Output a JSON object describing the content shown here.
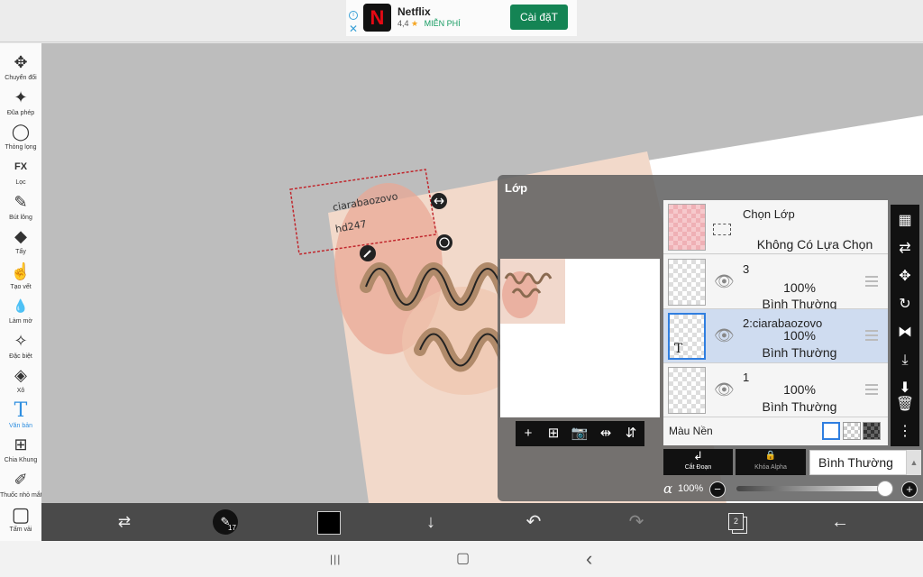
{
  "ad": {
    "title": "Netflix",
    "logo_letter": "N",
    "rating": "4,4",
    "star": "★",
    "badge": "MIỄN PHÍ",
    "install_label": "Cài đặT",
    "info_glyph": "i",
    "close_glyph": "✕"
  },
  "tools": [
    {
      "label": "Chuyển đổi",
      "icon": "move-icon",
      "glyph": "✥"
    },
    {
      "label": "Đũa phép",
      "icon": "magic-wand-icon",
      "glyph": "✦"
    },
    {
      "label": "Thòng lọng",
      "icon": "lasso-icon",
      "glyph": "◯"
    },
    {
      "label": "Lọc",
      "icon": "fx-icon",
      "glyph": "FX"
    },
    {
      "label": "Bút lông",
      "icon": "brush-icon",
      "glyph": "✎"
    },
    {
      "label": "Tẩy",
      "icon": "eraser-icon",
      "glyph": "◆"
    },
    {
      "label": "Tạo vết",
      "icon": "smudge-icon",
      "glyph": "☝"
    },
    {
      "label": "Làm mờ",
      "icon": "blur-icon",
      "glyph": "💧"
    },
    {
      "label": "Đặc biệt",
      "icon": "special-icon",
      "glyph": "✧"
    },
    {
      "label": "Xô",
      "icon": "bucket-icon",
      "glyph": "◈"
    },
    {
      "label": "Văn bản",
      "icon": "text-tool-icon",
      "glyph": "T"
    },
    {
      "label": "Chia Khung",
      "icon": "frame-divider-icon",
      "glyph": "⊞"
    },
    {
      "label": "Thuốc nhỏ mắt",
      "icon": "eyedropper-icon",
      "glyph": "✐"
    },
    {
      "label": "Tấm vải",
      "icon": "canvas-icon",
      "glyph": "▢"
    }
  ],
  "canvas": {
    "text_line1": "ciarabaozovo",
    "text_line2": "hd247"
  },
  "layer_panel": {
    "title": "Lớp",
    "selection_layer": {
      "title": "Chọn Lớp",
      "status": "Không Có Lựa Chọn"
    },
    "layers": [
      {
        "name": "3",
        "opacity": "100%",
        "blend": "Bình Thường",
        "selected": false
      },
      {
        "name": "2:ciarabaozovo",
        "opacity": "100%",
        "blend": "Bình Thường",
        "selected": true,
        "thumb_glyph": "T"
      },
      {
        "name": "1",
        "opacity": "100%",
        "blend": "Bình Thường",
        "selected": false
      }
    ],
    "background_label": "Màu Nền",
    "clip_label": "Cắt Đoạn",
    "alpha_lock_label": "Khóa Alpha",
    "blend_mode": "Bình Thường",
    "blend_arrow": "▲",
    "alpha_symbol": "α",
    "opacity_value": "100%",
    "opacity_fraction": 1.0,
    "minus_glyph": "−",
    "plus_glyph": "+",
    "eye_glyph": "👁",
    "preview_tool_glyphs": [
      "+",
      "⊞",
      "📷",
      "⇹",
      "⇵"
    ],
    "side_icon_glyphs": [
      "▦",
      "⇄",
      "✥",
      "↻",
      "⧓",
      "⤓",
      "⬇",
      "🗑",
      "⋮"
    ],
    "clip_glyph": "↲",
    "lock_glyph": "🔒"
  },
  "bottom_bar": {
    "brush_size": "17",
    "page_count": "2",
    "swap_glyph": "⇄",
    "brush_glyph": "✎",
    "down_glyph": "↓",
    "undo_glyph": "↶",
    "redo_glyph": "↷",
    "back_glyph": "←"
  },
  "system_nav": {
    "recents_glyph": "|||",
    "home_glyph": "▢",
    "back_glyph": "‹"
  },
  "colors": {
    "accent": "#2f8fe0",
    "install_button": "#148454",
    "selected_layer": "#cfdcf0",
    "primary_color": "#000000"
  }
}
